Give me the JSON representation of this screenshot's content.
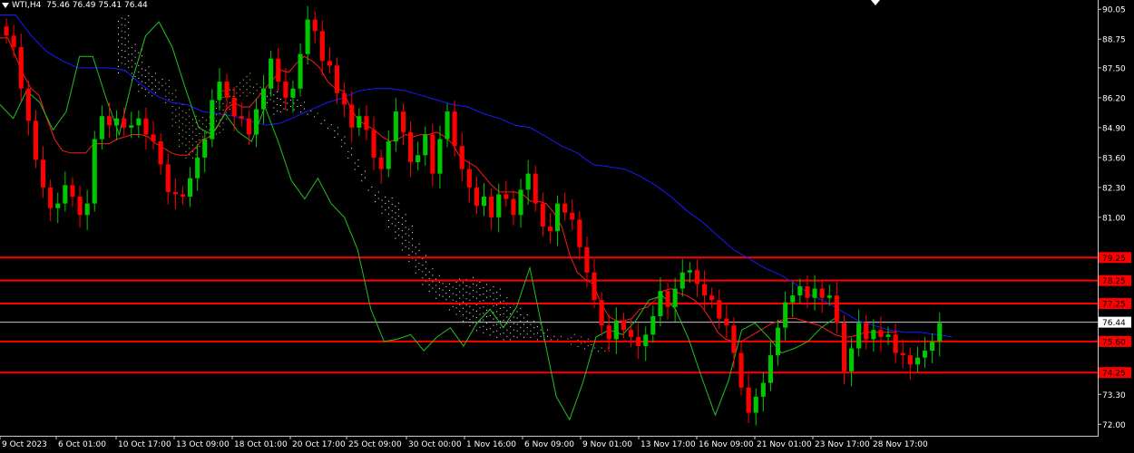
{
  "header": {
    "symbol": "WTI,H4",
    "ohlc": "75.46 76.49 75.41 76.44"
  },
  "colors": {
    "background": "#000000",
    "bull": "#00c800",
    "bear": "#ff0000",
    "kijun": "#1a1aff",
    "tenkan": "#ff1a1a",
    "chikou": "#22c022",
    "cloud_a": "#f2c27a",
    "cloud_b": "#ffffff",
    "level": "#ff0000",
    "price_line": "#c8c8c8"
  },
  "chart_data": {
    "type": "candlestick",
    "y_ticks": [
      "90.05",
      "88.75",
      "87.50",
      "86.20",
      "84.90",
      "83.60",
      "82.30",
      "81.00",
      "73.30",
      "72.00"
    ],
    "y_range": [
      71.5,
      90.45
    ],
    "x_ticks": [
      "9 Oct 2023",
      "6 Oct 01:00",
      "10 Oct 17:00",
      "13 Oct 09:00",
      "18 Oct 01:00",
      "20 Oct 17:00",
      "25 Oct 09:00",
      "30 Oct 00:00",
      "1 Nov 16:00",
      "6 Nov 09:00",
      "9 Nov 01:00",
      "13 Nov 17:00",
      "16 Nov 09:00",
      "21 Nov 01:00",
      "23 Nov 17:00",
      "28 Nov 17:00"
    ],
    "current_price": "76.44",
    "levels": [
      {
        "label": "79.25",
        "value": 79.25
      },
      {
        "label": "78.25",
        "value": 78.25
      },
      {
        "label": "77.25",
        "value": 77.25
      },
      {
        "label": "75.60",
        "value": 75.6
      },
      {
        "label": "74.25",
        "value": 74.25
      }
    ],
    "close": [
      88.9,
      88.4,
      86.6,
      85.2,
      83.5,
      82.3,
      81.4,
      81.6,
      82.4,
      81.9,
      81.1,
      81.6,
      84.4,
      85.4,
      85.0,
      85.3,
      84.9,
      85.0,
      85.3,
      84.6,
      84.3,
      83.3,
      82.1,
      82.0,
      81.9,
      82.7,
      83.6,
      84.4,
      86.1,
      86.9,
      86.2,
      85.4,
      85.3,
      84.6,
      85.7,
      86.6,
      87.9,
      86.9,
      86.2,
      86.6,
      88.1,
      89.6,
      89.1,
      87.8,
      87.6,
      86.4,
      85.9,
      84.9,
      85.4,
      84.8,
      83.6,
      83.1,
      84.3,
      85.6,
      84.7,
      83.4,
      83.7,
      84.6,
      82.9,
      84.4,
      85.6,
      84.1,
      83.1,
      82.3,
      81.5,
      81.9,
      81.0,
      82.0,
      81.8,
      81.1,
      82.2,
      82.9,
      81.6,
      80.6,
      80.4,
      81.6,
      81.2,
      80.9,
      79.7,
      78.6,
      77.4,
      76.3,
      75.7,
      76.5,
      76.1,
      75.8,
      75.4,
      75.9,
      76.7,
      77.8,
      77.1,
      77.9,
      78.6,
      78.7,
      78.1,
      77.6,
      77.4,
      76.6,
      76.3,
      75.1,
      73.6,
      72.5,
      73.2,
      73.8,
      75.0,
      76.2,
      77.3,
      77.6,
      78.0,
      77.5,
      77.9,
      77.5,
      77.6,
      76.4,
      74.3,
      75.3,
      76.4,
      75.7,
      76.1,
      75.8,
      75.9,
      75.1,
      75.0,
      74.6,
      74.9,
      75.2,
      75.6,
      76.4
    ],
    "tenkan": [
      88.8,
      88.8,
      88.0,
      87.2,
      86.6,
      86.3,
      85.3,
      84.4,
      83.9,
      83.8,
      83.8,
      83.8,
      84.2,
      84.2,
      84.2,
      84.4,
      84.5,
      84.6,
      84.6,
      84.5,
      84.2,
      84.0,
      83.8,
      83.7,
      83.7,
      84.0,
      84.4,
      84.5,
      85.0,
      85.7,
      86.0,
      85.8,
      85.8,
      86.2,
      86.6,
      87.0,
      87.4,
      87.3,
      87.7,
      88.0,
      87.8,
      87.5,
      86.9,
      86.6,
      86.5,
      85.7,
      85.2,
      85.0,
      84.8,
      84.5,
      84.3,
      84.4,
      84.6,
      84.5,
      84.6,
      84.6,
      84.7,
      84.5,
      84.2,
      83.6,
      83.4,
      83.2,
      82.8,
      82.4,
      82.1,
      82.1,
      82.1,
      82.0,
      81.7,
      81.7,
      81.6,
      81.2,
      80.6,
      79.4,
      78.6,
      78.3,
      78.1,
      77.3,
      76.7,
      76.5,
      76.5,
      76.6,
      77.0,
      77.1,
      77.4,
      77.8,
      77.9,
      77.7,
      77.6,
      77.4,
      77.1,
      76.6,
      76.0,
      75.7,
      75.6,
      75.6,
      75.8,
      76.0,
      76.2,
      76.4,
      76.5,
      76.6,
      76.6,
      76.5,
      76.4,
      76.3,
      76.1,
      75.9,
      75.8,
      75.8,
      75.9,
      76.0,
      76.0,
      76.0,
      76.0,
      76.0
    ],
    "kijun": [
      89.8,
      89.8,
      88.9,
      88.2,
      87.8,
      87.5,
      87.5,
      87.5,
      87.4,
      86.8,
      86.3,
      86.0,
      85.9,
      85.6,
      85.5,
      85.4,
      85.2,
      85.0,
      85.1,
      85.4,
      85.7,
      86.0,
      86.2,
      86.5,
      86.6,
      86.6,
      86.5,
      86.3,
      86.1,
      85.9,
      85.8,
      85.5,
      85.3,
      85.0,
      84.9,
      84.5,
      84.1,
      83.8,
      83.3,
      83.2,
      83.1,
      82.8,
      82.4,
      81.9,
      81.3,
      80.8,
      80.2,
      79.6,
      79.2,
      78.8,
      78.5,
      78.1,
      77.6,
      77.3,
      76.9,
      76.5,
      76.3,
      76.1,
      76.0,
      76.0,
      75.9,
      75.8
    ],
    "chikou": [
      85.9,
      85.3,
      86.5,
      86.0,
      84.8,
      85.6,
      88.0,
      88.0,
      86.2,
      84.6,
      87.0,
      88.9,
      89.5,
      88.4,
      86.6,
      84.9,
      84.6,
      85.5,
      84.7,
      84.3,
      85.8,
      84.3,
      82.6,
      81.8,
      82.7,
      81.6,
      81.0,
      79.6,
      77.0,
      75.6,
      75.7,
      75.9,
      75.2,
      75.8,
      76.2,
      75.4,
      76.4,
      77.0,
      76.2,
      77.1,
      78.8,
      76.0,
      73.2,
      72.2,
      73.8,
      75.8,
      76.1,
      75.9,
      76.5,
      77.4,
      77.6,
      77.0,
      75.7,
      74.0,
      72.4,
      73.9,
      76.1,
      76.4,
      75.8,
      75.1,
      75.3,
      75.6,
      76.2,
      76.6
    ],
    "senkou_a": [
      87.3,
      87.4,
      87.0,
      86.5,
      86.3,
      86.3,
      86.6,
      87.0,
      86.4,
      86.0,
      85.8,
      85.3,
      85.3,
      85.5,
      85.9,
      86.4,
      86.6,
      86.8,
      86.9,
      87.2,
      86.9,
      86.7,
      86.0,
      85.5,
      85.6,
      85.7,
      85.7,
      85.6,
      85.5,
      85.4,
      85.1,
      84.9,
      84.5,
      84.1,
      83.6,
      83.1,
      82.6,
      82.2,
      81.7,
      81.2,
      80.6,
      80.1,
      79.6,
      79.1,
      78.6,
      78.1,
      77.8,
      77.5,
      77.3,
      77.0,
      76.8,
      76.5,
      76.3,
      76.1,
      76.0,
      75.9,
      75.8,
      75.7,
      75.7,
      75.8,
      75.8,
      75.8,
      75.7,
      75.7,
      75.7,
      75.8,
      75.8,
      75.8,
      75.7,
      75.6,
      75.5,
      75.3,
      75.2
    ],
    "senkou_b": [
      89.8,
      89.8,
      88.4,
      88.2,
      87.5,
      87.3,
      86.9,
      86.0,
      85.0,
      84.1,
      83.6,
      83.6,
      84.1,
      84.4,
      84.5,
      84.7,
      85.3,
      86.0,
      86.3,
      86.3,
      86.4,
      86.4,
      86.4,
      86.4,
      86.3,
      86.2,
      86.1,
      85.9,
      85.7,
      85.4,
      85.3,
      85.0,
      84.9,
      84.4,
      84.0,
      83.5,
      83.0,
      82.3,
      82.2,
      82.0,
      81.9,
      81.6,
      81.1,
      80.5,
      79.8,
      79.3,
      78.7,
      78.5,
      78.4,
      78.3,
      78.3,
      78.3,
      78.3,
      78.3,
      78.2,
      78.0,
      77.8,
      77.5,
      77.3,
      77.0,
      76.8,
      76.5,
      76.3,
      76.0,
      75.8,
      75.7,
      75.6,
      75.5,
      75.4,
      75.3,
      75.2,
      75.2,
      75.2
    ]
  }
}
